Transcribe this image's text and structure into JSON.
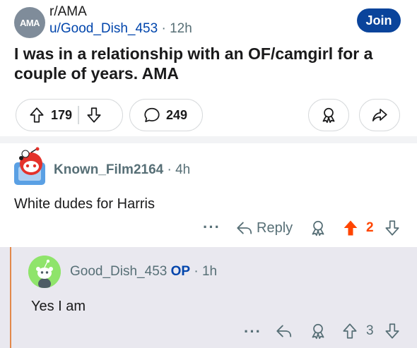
{
  "post": {
    "subreddit_badge": "AMA",
    "subreddit": "r/AMA",
    "author": "u/Good_Dish_453",
    "separator": "·",
    "age": "12h",
    "join_label": "Join",
    "title": "I was in a relationship with an OF/camgirl for a couple of years. AMA",
    "upvotes": "179",
    "comments": "249"
  },
  "comment1": {
    "author": "Known_Film2164",
    "separator": "·",
    "age": "4h",
    "body": "White dudes for Harris",
    "more": "···",
    "reply_label": "Reply",
    "score": "2",
    "score_color": "#ff4500"
  },
  "comment2": {
    "author": "Good_Dish_453",
    "op_badge": "OP",
    "separator": "·",
    "age": "1h",
    "body": "Yes I am",
    "more": "···",
    "score": "3"
  },
  "colors": {
    "join_bg": "#0a449b",
    "thread_line": "#e2884a",
    "nested_bg": "#e9e8ef",
    "op_badge": "#0045ac"
  }
}
